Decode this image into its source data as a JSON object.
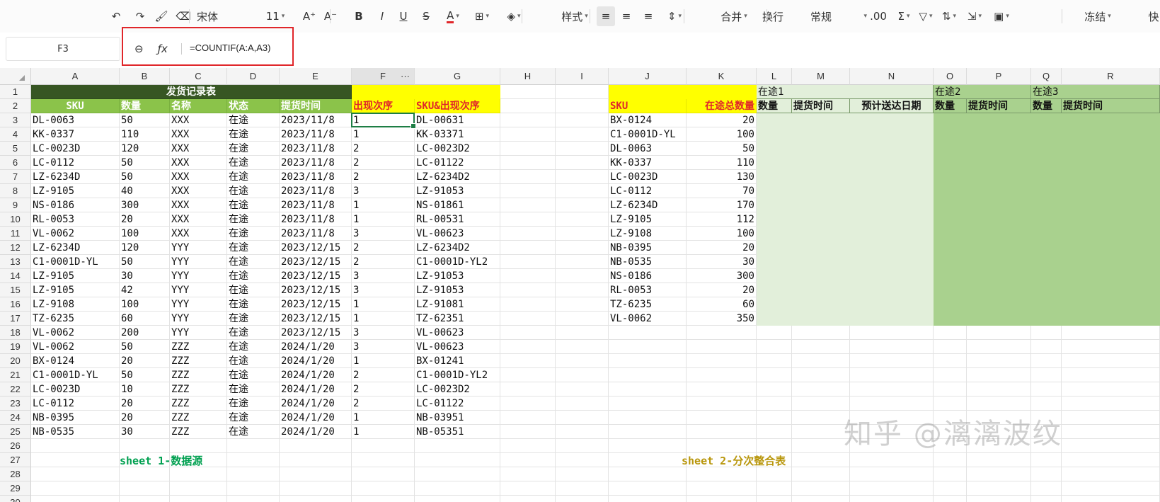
{
  "toolbar": {
    "items": [
      {
        "name": "undo-icon",
        "glyph": "↶"
      },
      {
        "name": "redo-icon",
        "glyph": "↷"
      },
      {
        "name": "format-painter-icon",
        "glyph": "🖌"
      },
      {
        "name": "eraser-icon",
        "glyph": "⌫"
      },
      {
        "name": "font-name",
        "glyph": "宋体"
      },
      {
        "name": "font-size",
        "glyph": "11"
      },
      {
        "name": "font-grow-icon",
        "glyph": "A⁺"
      },
      {
        "name": "font-shrink-icon",
        "glyph": "A⁻"
      },
      {
        "name": "bold-icon",
        "glyph": "B"
      },
      {
        "name": "italic-icon",
        "glyph": "I"
      },
      {
        "name": "underline-icon",
        "glyph": "U"
      },
      {
        "name": "strikethrough-icon",
        "glyph": "S"
      },
      {
        "name": "font-color-icon",
        "glyph": "A"
      },
      {
        "name": "border-icon",
        "glyph": "⊞"
      },
      {
        "name": "fill-color-icon",
        "glyph": "◈"
      },
      {
        "name": "style-button",
        "glyph": "样式"
      },
      {
        "name": "align-left-icon",
        "glyph": "≡"
      },
      {
        "name": "align-center-icon",
        "glyph": "≡"
      },
      {
        "name": "align-right-icon",
        "glyph": "≡"
      },
      {
        "name": "vertical-align-icon",
        "glyph": "⇕"
      },
      {
        "name": "merge-button",
        "glyph": "合并"
      },
      {
        "name": "wrap-button",
        "glyph": "换行"
      },
      {
        "name": "number-format-select",
        "glyph": "常规"
      },
      {
        "name": "decimal-icon",
        "glyph": ".00"
      },
      {
        "name": "sum-icon",
        "glyph": "Σ"
      },
      {
        "name": "filter-icon",
        "glyph": "▽"
      },
      {
        "name": "sort-icon",
        "glyph": "⇅"
      },
      {
        "name": "fill-icon",
        "glyph": "⇲"
      },
      {
        "name": "image-icon",
        "glyph": "▣"
      },
      {
        "name": "freeze-button",
        "glyph": "冻结"
      },
      {
        "name": "quick-button",
        "glyph": "快"
      }
    ]
  },
  "formula_bar": {
    "name_box": "F3",
    "zoom_icon": "⊖",
    "fx_icon": "ƒx",
    "formula": "=COUNTIF(A:A,A3)"
  },
  "columns": [
    "A",
    "B",
    "C",
    "D",
    "E",
    "F",
    "G",
    "H",
    "I",
    "J",
    "K",
    "L",
    "M",
    "N",
    "O",
    "P",
    "Q",
    "R"
  ],
  "rows": [
    "1",
    "2",
    "3",
    "4",
    "5",
    "6",
    "7",
    "8",
    "9",
    "10",
    "11",
    "12",
    "13",
    "14",
    "15",
    "16",
    "17",
    "18",
    "19",
    "20",
    "21",
    "22",
    "23",
    "24",
    "25",
    "26",
    "27",
    "28",
    "29",
    "30"
  ],
  "colors": {
    "dark_green": "#375623",
    "mid_green": "#8bc34a",
    "yellow": "#ffff00",
    "red_text": "#e0262a",
    "light_green": "#e2efda",
    "green_fill": "#a9d18e",
    "note_green": "#00a050",
    "note_gold": "#b8960b"
  },
  "sheet1": {
    "title": "发货记录表",
    "headers": [
      "SKU",
      "数量",
      "名称",
      "状态",
      "提货时间",
      "出现次序",
      "SKU&出现次序"
    ],
    "rows": [
      [
        "DL-0063",
        "50",
        "XXX",
        "在途",
        "2023/11/8",
        "1",
        "DL-00631"
      ],
      [
        "KK-0337",
        "110",
        "XXX",
        "在途",
        "2023/11/8",
        "1",
        "KK-03371"
      ],
      [
        "LC-0023D",
        "120",
        "XXX",
        "在途",
        "2023/11/8",
        "2",
        "LC-0023D2"
      ],
      [
        "LC-0112",
        "50",
        "XXX",
        "在途",
        "2023/11/8",
        "2",
        "LC-01122"
      ],
      [
        "LZ-6234D",
        "50",
        "XXX",
        "在途",
        "2023/11/8",
        "2",
        "LZ-6234D2"
      ],
      [
        "LZ-9105",
        "40",
        "XXX",
        "在途",
        "2023/11/8",
        "3",
        "LZ-91053"
      ],
      [
        "NS-0186",
        "300",
        "XXX",
        "在途",
        "2023/11/8",
        "1",
        "NS-01861"
      ],
      [
        "RL-0053",
        "20",
        "XXX",
        "在途",
        "2023/11/8",
        "1",
        "RL-00531"
      ],
      [
        "VL-0062",
        "100",
        "XXX",
        "在途",
        "2023/11/8",
        "3",
        "VL-00623"
      ],
      [
        "LZ-6234D",
        "120",
        "YYY",
        "在途",
        "2023/12/15",
        "2",
        "LZ-6234D2"
      ],
      [
        "C1-0001D-YL",
        "50",
        "YYY",
        "在途",
        "2023/12/15",
        "2",
        "C1-0001D-YL2"
      ],
      [
        "LZ-9105",
        "30",
        "YYY",
        "在途",
        "2023/12/15",
        "3",
        "LZ-91053"
      ],
      [
        "LZ-9105",
        "42",
        "YYY",
        "在途",
        "2023/12/15",
        "3",
        "LZ-91053"
      ],
      [
        "LZ-9108",
        "100",
        "YYY",
        "在途",
        "2023/12/15",
        "1",
        "LZ-91081"
      ],
      [
        "TZ-6235",
        "60",
        "YYY",
        "在途",
        "2023/12/15",
        "1",
        "TZ-62351"
      ],
      [
        "VL-0062",
        "200",
        "YYY",
        "在途",
        "2023/12/15",
        "3",
        "VL-00623"
      ],
      [
        "VL-0062",
        "50",
        "ZZZ",
        "在途",
        "2024/1/20",
        "3",
        "VL-00623"
      ],
      [
        "BX-0124",
        "20",
        "ZZZ",
        "在途",
        "2024/1/20",
        "1",
        "BX-01241"
      ],
      [
        "C1-0001D-YL",
        "50",
        "ZZZ",
        "在途",
        "2024/1/20",
        "2",
        "C1-0001D-YL2"
      ],
      [
        "LC-0023D",
        "10",
        "ZZZ",
        "在途",
        "2024/1/20",
        "2",
        "LC-0023D2"
      ],
      [
        "LC-0112",
        "20",
        "ZZZ",
        "在途",
        "2024/1/20",
        "2",
        "LC-01122"
      ],
      [
        "NB-0395",
        "20",
        "ZZZ",
        "在途",
        "2024/1/20",
        "1",
        "NB-03951"
      ],
      [
        "NB-0535",
        "30",
        "ZZZ",
        "在途",
        "2024/1/20",
        "1",
        "NB-05351"
      ]
    ],
    "note": "sheet 1-数据源"
  },
  "sheet2": {
    "headers": [
      "SKU",
      "在途总数量"
    ],
    "group_labels": [
      "在途1",
      "在途2",
      "在途3"
    ],
    "sub_headers": [
      "数量",
      "提货时间",
      "预计送达日期",
      "数量",
      "提货时间",
      "数量",
      "提货时间"
    ],
    "rows": [
      [
        "BX-0124",
        "20"
      ],
      [
        "C1-0001D-YL",
        "100"
      ],
      [
        "DL-0063",
        "50"
      ],
      [
        "KK-0337",
        "110"
      ],
      [
        "LC-0023D",
        "130"
      ],
      [
        "LC-0112",
        "70"
      ],
      [
        "LZ-6234D",
        "170"
      ],
      [
        "LZ-9105",
        "112"
      ],
      [
        "LZ-9108",
        "100"
      ],
      [
        "NB-0395",
        "20"
      ],
      [
        "NB-0535",
        "30"
      ],
      [
        "NS-0186",
        "300"
      ],
      [
        "RL-0053",
        "20"
      ],
      [
        "TZ-6235",
        "60"
      ],
      [
        "VL-0062",
        "350"
      ]
    ],
    "note": "sheet 2-分次整合表"
  },
  "watermark": "知乎 @漓漓波纹"
}
